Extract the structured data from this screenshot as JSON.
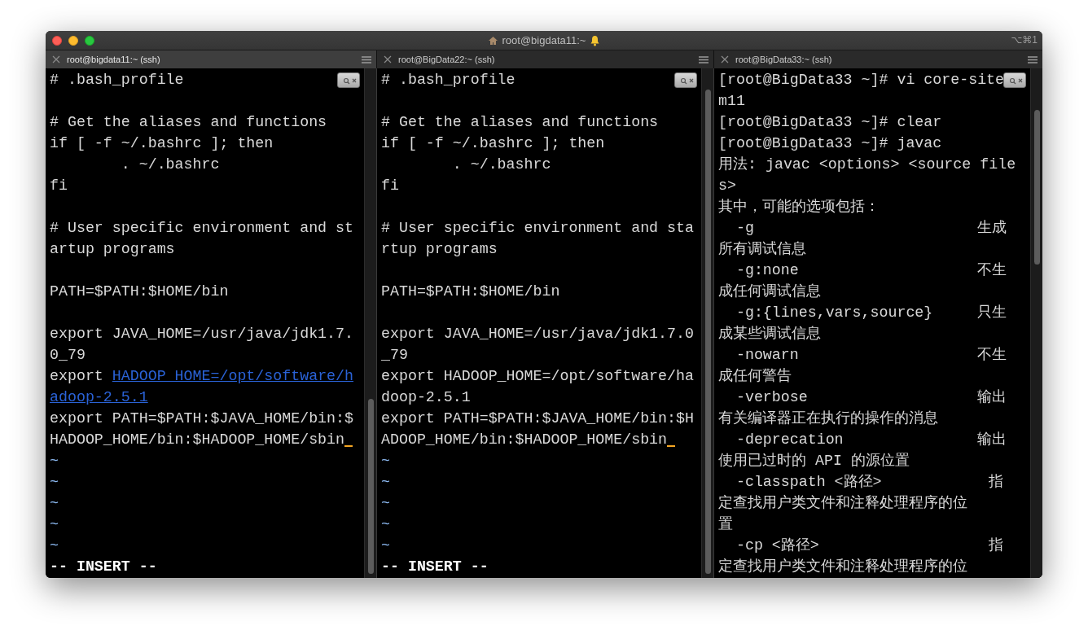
{
  "window": {
    "title": "root@bigdata11:~",
    "shortcut": "⌥⌘1"
  },
  "tabs": [
    {
      "label": "root@bigdata11:~ (ssh)",
      "selected": true
    },
    {
      "label": "root@BigData22:~ (ssh)",
      "selected": false
    },
    {
      "label": "root@BigData33:~ (ssh)",
      "selected": false
    }
  ],
  "panes": [
    {
      "lines": [
        {
          "kind": "text",
          "text": "# .bash_profile",
          "cursor": false
        },
        {
          "kind": "blank",
          "cursor": false
        },
        {
          "kind": "text",
          "text": "# Get the aliases and functions",
          "cursor": false
        },
        {
          "kind": "text",
          "text": "if [ -f ~/.bashrc ]; then",
          "cursor": false
        },
        {
          "kind": "text",
          "text": "        . ~/.bashrc",
          "cursor": false
        },
        {
          "kind": "text",
          "text": "fi",
          "cursor": false
        },
        {
          "kind": "blank",
          "cursor": false
        },
        {
          "kind": "text",
          "text": "# User specific environment and st",
          "cursor": false
        },
        {
          "kind": "text",
          "text": "artup programs",
          "cursor": false
        },
        {
          "kind": "blank",
          "cursor": false
        },
        {
          "kind": "text",
          "text": "PATH=$PATH:$HOME/bin",
          "cursor": false
        },
        {
          "kind": "blank",
          "cursor": false
        },
        {
          "kind": "text",
          "text": "export JAVA_HOME=/usr/java/jdk1.7.",
          "cursor": false
        },
        {
          "kind": "text",
          "text": "0_79",
          "cursor": false
        },
        {
          "kind": "text",
          "text": "export",
          "link": "HADOOP_HOME=/opt/software/h",
          "cursor": false
        },
        {
          "kind": "link",
          "text": "adoop-2.5.1",
          "cursor": false
        },
        {
          "kind": "text",
          "text": "export PATH=$PATH:$JAVA_HOME/bin:$",
          "cursor": false
        },
        {
          "kind": "text",
          "text": "HADOOP_HOME/bin:$HADOOP_HOME/sbin",
          "cursor": true
        },
        {
          "kind": "tilde",
          "text": "~",
          "cursor": false
        },
        {
          "kind": "tilde",
          "text": "~",
          "cursor": false
        },
        {
          "kind": "tilde",
          "text": "~",
          "cursor": false
        },
        {
          "kind": "tilde",
          "text": "~",
          "cursor": false
        },
        {
          "kind": "tilde",
          "text": "~",
          "cursor": false
        },
        {
          "kind": "mode",
          "text": "-- INSERT --",
          "cursor": false
        }
      ]
    },
    {
      "lines": [
        {
          "kind": "text",
          "text": "# .bash_profile",
          "cursor": false
        },
        {
          "kind": "blank",
          "cursor": false
        },
        {
          "kind": "text",
          "text": "# Get the aliases and functions",
          "cursor": false
        },
        {
          "kind": "text",
          "text": "if [ -f ~/.bashrc ]; then",
          "cursor": false
        },
        {
          "kind": "text",
          "text": "        . ~/.bashrc",
          "cursor": false
        },
        {
          "kind": "text",
          "text": "fi",
          "cursor": false
        },
        {
          "kind": "blank",
          "cursor": false
        },
        {
          "kind": "text",
          "text": "# User specific environment and sta",
          "cursor": false
        },
        {
          "kind": "text",
          "text": "rtup programs",
          "cursor": false
        },
        {
          "kind": "blank",
          "cursor": false
        },
        {
          "kind": "text",
          "text": "PATH=$PATH:$HOME/bin",
          "cursor": false
        },
        {
          "kind": "blank",
          "cursor": false
        },
        {
          "kind": "text",
          "text": "export JAVA_HOME=/usr/java/jdk1.7.0",
          "cursor": false
        },
        {
          "kind": "text",
          "text": "_79",
          "cursor": false
        },
        {
          "kind": "text",
          "text": "export HADOOP_HOME=/opt/software/ha",
          "cursor": false
        },
        {
          "kind": "text",
          "text": "doop-2.5.1",
          "cursor": false
        },
        {
          "kind": "text",
          "text": "export PATH=$PATH:$JAVA_HOME/bin:$H",
          "cursor": false
        },
        {
          "kind": "text",
          "text": "ADOOP_HOME/bin:$HADOOP_HOME/sbin",
          "cursor": true
        },
        {
          "kind": "tilde",
          "text": "~",
          "cursor": false
        },
        {
          "kind": "tilde",
          "text": "~",
          "cursor": false
        },
        {
          "kind": "tilde",
          "text": "~",
          "cursor": false
        },
        {
          "kind": "tilde",
          "text": "~",
          "cursor": false
        },
        {
          "kind": "tilde",
          "text": "~",
          "cursor": false
        },
        {
          "kind": "mode",
          "text": "-- INSERT --",
          "cursor": false
        }
      ]
    },
    {
      "lines": [
        {
          "kind": "text",
          "text": "[root@BigData33 ~]# vi core-site",
          "cursor": false
        },
        {
          "kind": "text",
          "text": "m11",
          "cursor": false
        },
        {
          "kind": "text",
          "text": "[root@BigData33 ~]# clear",
          "cursor": false
        },
        {
          "kind": "text",
          "text": "[root@BigData33 ~]# javac",
          "cursor": false
        },
        {
          "kind": "text",
          "text": "用法: javac <options> <source file",
          "cursor": false
        },
        {
          "kind": "text",
          "text": "s>",
          "cursor": false
        },
        {
          "kind": "text",
          "text": "其中，可能的选项包括：",
          "cursor": false
        },
        {
          "kind": "text",
          "text": "  -g                         生成",
          "cursor": false
        },
        {
          "kind": "text",
          "text": "所有调试信息",
          "cursor": false
        },
        {
          "kind": "text",
          "text": "  -g:none                    不生",
          "cursor": false
        },
        {
          "kind": "text",
          "text": "成任何调试信息",
          "cursor": false
        },
        {
          "kind": "text",
          "text": "  -g:{lines,vars,source}     只生",
          "cursor": false
        },
        {
          "kind": "text",
          "text": "成某些调试信息",
          "cursor": false
        },
        {
          "kind": "text",
          "text": "  -nowarn                    不生",
          "cursor": false
        },
        {
          "kind": "text",
          "text": "成任何警告",
          "cursor": false
        },
        {
          "kind": "text",
          "text": "  -verbose                   输出",
          "cursor": false
        },
        {
          "kind": "text",
          "text": "有关编译器正在执行的操作的消息",
          "cursor": false
        },
        {
          "kind": "text",
          "text": "  -deprecation               输出",
          "cursor": false
        },
        {
          "kind": "text",
          "text": "使用已过时的 API 的源位置",
          "cursor": false
        },
        {
          "kind": "text",
          "text": "  -classpath <路径>            指",
          "cursor": false
        },
        {
          "kind": "text",
          "text": "定查找用户类文件和注释处理程序的位",
          "cursor": false
        },
        {
          "kind": "text",
          "text": "置",
          "cursor": false
        },
        {
          "kind": "text",
          "text": "  -cp <路径>                   指",
          "cursor": false
        },
        {
          "kind": "text",
          "text": "定查找用户类文件和注释处理程序的位",
          "cursor": false
        }
      ]
    }
  ]
}
